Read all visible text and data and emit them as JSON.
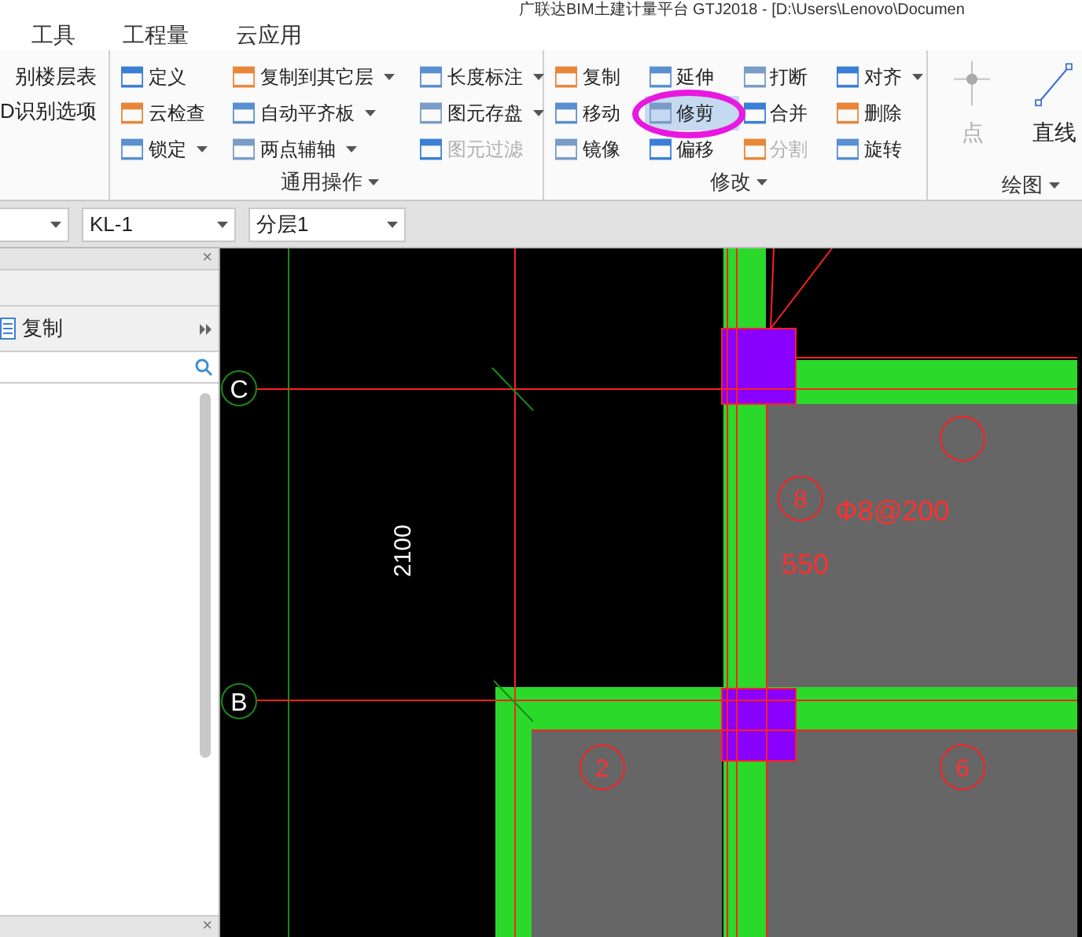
{
  "window": {
    "title": "广联达BIM土建计量平台 GTJ2018 - [D:\\Users\\Lenovo\\Documen"
  },
  "menu_tabs": [
    {
      "label": "工具",
      "selected": false
    },
    {
      "label": "工程量",
      "selected": false
    },
    {
      "label": "云应用",
      "selected": false
    }
  ],
  "ribbon": {
    "cut_group": {
      "items": [
        "别楼层表",
        "D识别选项"
      ]
    },
    "groups": [
      {
        "kind": "list",
        "title": "通用操作",
        "columns": [
          [
            {
              "label": "定义",
              "dropdown": false,
              "disabled": false,
              "selected": false
            },
            {
              "label": "云检查",
              "dropdown": false,
              "disabled": false,
              "selected": false
            },
            {
              "label": "锁定",
              "dropdown": true,
              "disabled": false,
              "selected": false
            }
          ],
          [
            {
              "label": "复制到其它层",
              "dropdown": true,
              "disabled": false,
              "selected": false
            },
            {
              "label": "自动平齐板",
              "dropdown": true,
              "disabled": false,
              "selected": false
            },
            {
              "label": "两点辅轴",
              "dropdown": true,
              "disabled": false,
              "selected": false
            }
          ],
          [
            {
              "label": "长度标注",
              "dropdown": true,
              "disabled": false,
              "selected": false
            },
            {
              "label": "图元存盘",
              "dropdown": true,
              "disabled": false,
              "selected": false
            },
            {
              "label": "图元过滤",
              "dropdown": false,
              "disabled": true,
              "selected": false
            }
          ]
        ]
      },
      {
        "kind": "list",
        "title": "修改",
        "columns": [
          [
            {
              "label": "复制",
              "dropdown": false,
              "disabled": false,
              "selected": false
            },
            {
              "label": "移动",
              "dropdown": false,
              "disabled": false,
              "selected": false
            },
            {
              "label": "镜像",
              "dropdown": false,
              "disabled": false,
              "selected": false
            }
          ],
          [
            {
              "label": "延伸",
              "dropdown": false,
              "disabled": false,
              "selected": false
            },
            {
              "label": "修剪",
              "dropdown": false,
              "disabled": false,
              "selected": true
            },
            {
              "label": "偏移",
              "dropdown": false,
              "disabled": false,
              "selected": false
            }
          ],
          [
            {
              "label": "打断",
              "dropdown": false,
              "disabled": false,
              "selected": false
            },
            {
              "label": "合并",
              "dropdown": false,
              "disabled": false,
              "selected": false
            },
            {
              "label": "分割",
              "dropdown": false,
              "disabled": true,
              "selected": false
            }
          ],
          [
            {
              "label": "对齐",
              "dropdown": true,
              "disabled": false,
              "selected": false
            },
            {
              "label": "删除",
              "dropdown": false,
              "disabled": false,
              "selected": false
            },
            {
              "label": "旋转",
              "dropdown": false,
              "disabled": false,
              "selected": false
            }
          ]
        ]
      },
      {
        "kind": "large",
        "title": "绘图",
        "items": [
          {
            "label": "点",
            "disabled": true
          },
          {
            "label": "直线",
            "disabled": false
          }
        ]
      }
    ]
  },
  "selectors": [
    {
      "value": "KL-1"
    },
    {
      "value": "分层1"
    }
  ],
  "side_panel": {
    "close_buttons": [
      "×",
      "×"
    ],
    "toolbar": [
      {
        "label": "复制"
      }
    ]
  },
  "drawing": {
    "axes": [
      {
        "label": "C"
      },
      {
        "label": "B"
      }
    ],
    "dimension": "2100",
    "rebar_text": "Φ8@200",
    "thickness_text": "550",
    "slab_marks": [
      {
        "label": "8"
      },
      {
        "label": "2"
      },
      {
        "label": "6"
      }
    ]
  }
}
